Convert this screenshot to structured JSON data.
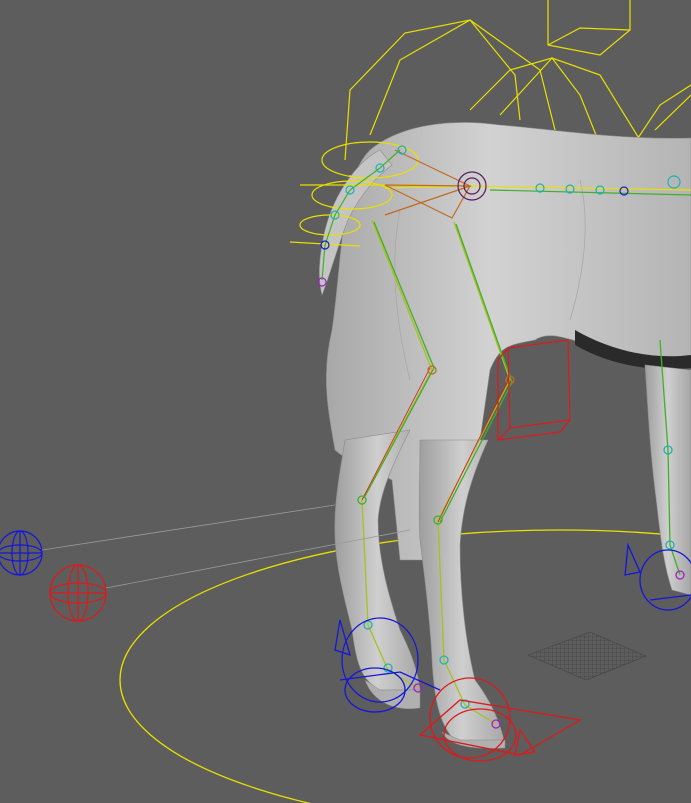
{
  "viewport": {
    "background": "#5d5d5d",
    "colors": {
      "mesh": "#c8c8c8",
      "mesh_shadow": "#9a9a9a",
      "control_yellow": "#e8e000",
      "ik_red": "#e01818",
      "pole_blue": "#1616d8",
      "bone_green": "#40b028",
      "bone_orange": "#c06a20",
      "joint_cyan": "#20b0b0",
      "joint_purple": "#a020c0",
      "ground_grid": "#3c3c3c"
    },
    "icons": [
      "horse-mesh-icon",
      "ground-circle-control-icon",
      "pole-vector-control-icon",
      "ik-handle-icon",
      "foot-control-icon",
      "bone-chain-icon"
    ]
  }
}
